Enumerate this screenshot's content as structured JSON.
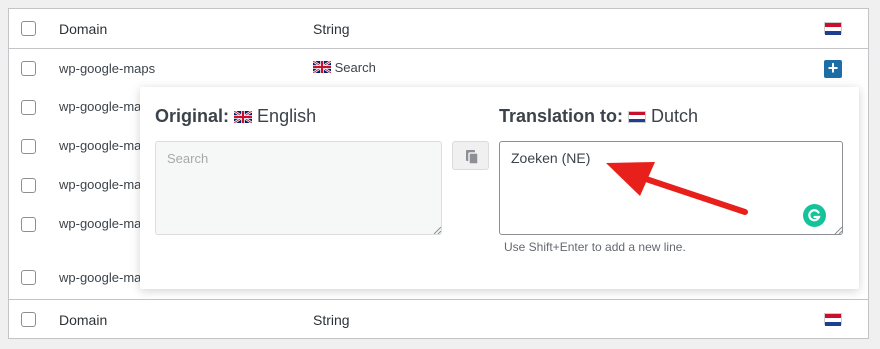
{
  "table": {
    "header": {
      "domain_label": "Domain",
      "string_label": "String",
      "flag_icon": "netherlands-flag-icon"
    },
    "rows": [
      {
        "domain": "wp-google-maps",
        "string": "Search",
        "flag_icon": "uk-flag-icon"
      },
      {
        "domain": "wp-google-maps"
      },
      {
        "domain": "wp-google-ma"
      },
      {
        "domain": "wp-google-ma"
      },
      {
        "domain": "wp-google-ma"
      },
      {
        "domain": "wp-google-ma"
      }
    ],
    "footer": {
      "domain_label": "Domain",
      "string_label": "String"
    },
    "add_button_label": "+"
  },
  "popup": {
    "original": {
      "label": "Original:",
      "language": "English",
      "placeholder": "Search"
    },
    "translation": {
      "label": "Translation to:",
      "language": "Dutch",
      "value": "Zoeken (NE)",
      "hint": "Use Shift+Enter to add a new line."
    }
  },
  "colors": {
    "accent": "#1d6ea7",
    "arrow": "#e8201b",
    "grammarly": "#15c39a"
  }
}
